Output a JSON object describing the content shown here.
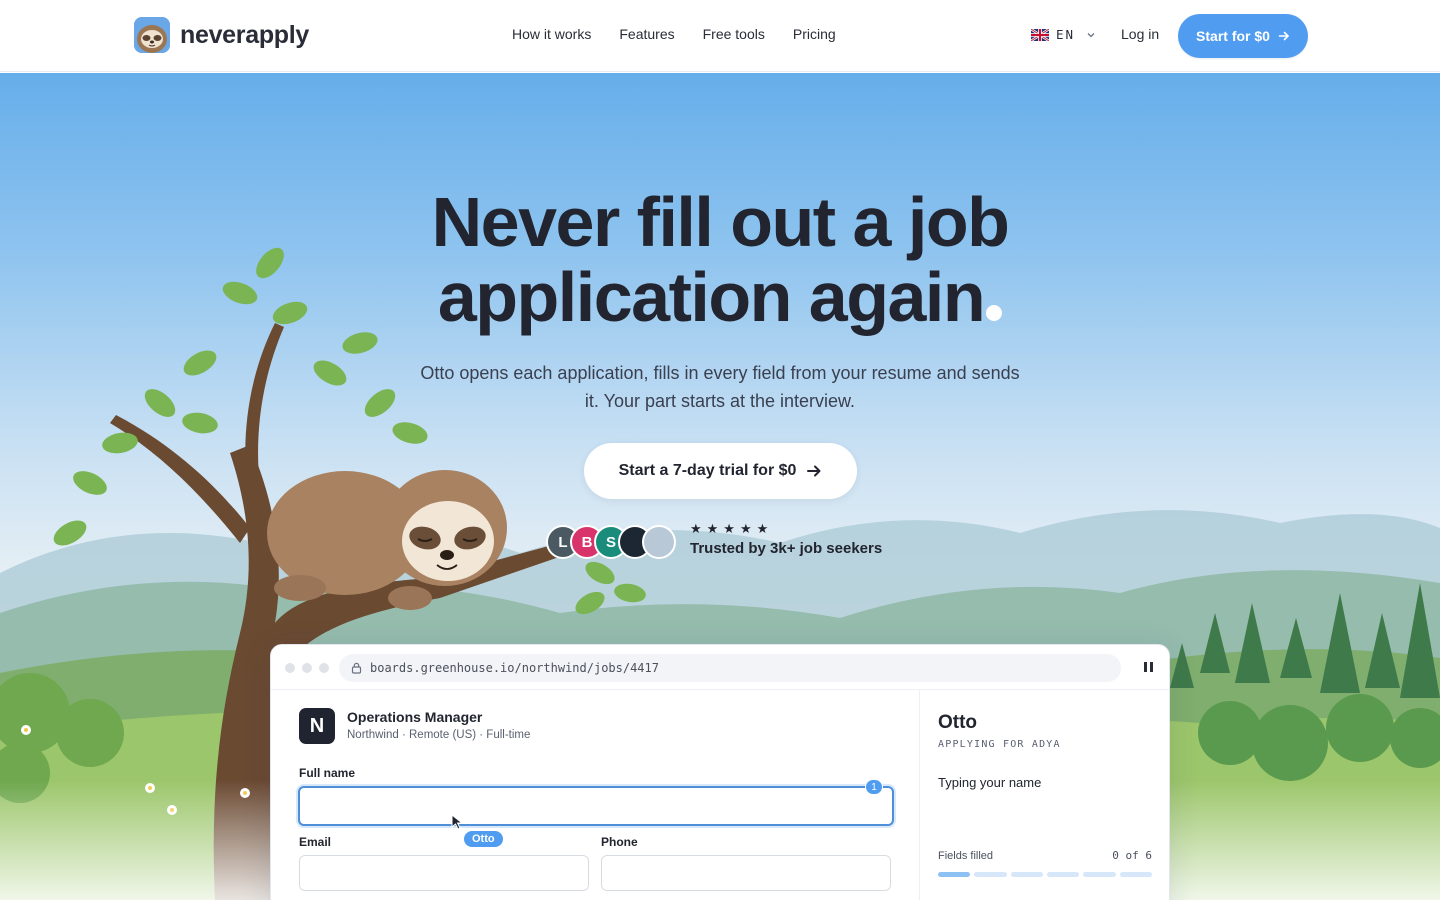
{
  "brand": {
    "name": "neverapply",
    "logo_icon": "sloth-face-icon",
    "accent": "#4f9cf0"
  },
  "nav": {
    "links": [
      "How it works",
      "Features",
      "Free tools",
      "Pricing"
    ],
    "lang_code": "EN",
    "lang_flag": "uk-flag-icon",
    "login": "Log in",
    "cta": "Start for $0"
  },
  "hero": {
    "headline_line1": "Never fill out a job",
    "headline_line2": "application again",
    "subtitle": "Otto opens each application, fills in every field from your resume and sends it. Your part starts at the interview.",
    "cta": "Start a 7-day trial for $0",
    "stars": "★★★★★",
    "rating_value": 5,
    "trust_text": "Trusted by 3k+ job seekers",
    "avatars": [
      {
        "initial": "L",
        "color": "#4b5a62"
      },
      {
        "initial": "B",
        "color": "#d8336b"
      },
      {
        "initial": "S",
        "color": "#1a8c7c"
      },
      {
        "initial": "",
        "color": "#1c2733"
      },
      {
        "initial": "",
        "color": "#b8c8d6"
      }
    ]
  },
  "app_demo": {
    "url": "boards.greenhouse.io/northwind/jobs/4417",
    "company_initial": "N",
    "job_title": "Operations Manager",
    "job_meta": "Northwind · Remote (US) · Full-time",
    "fields": {
      "full_name_label": "Full name",
      "full_name_value": "",
      "email_label": "Email",
      "email_value": "",
      "phone_label": "Phone",
      "phone_value": ""
    },
    "step_badge": "1",
    "cursor_tag": "Otto",
    "side": {
      "agent_name": "Otto",
      "applying_for": "APPLYING FOR ADYA",
      "status": "Typing your name",
      "fields_filled_label": "Fields filled",
      "fields_filled_count": "0 of 6",
      "progress_filled": 0,
      "progress_total": 6
    }
  }
}
